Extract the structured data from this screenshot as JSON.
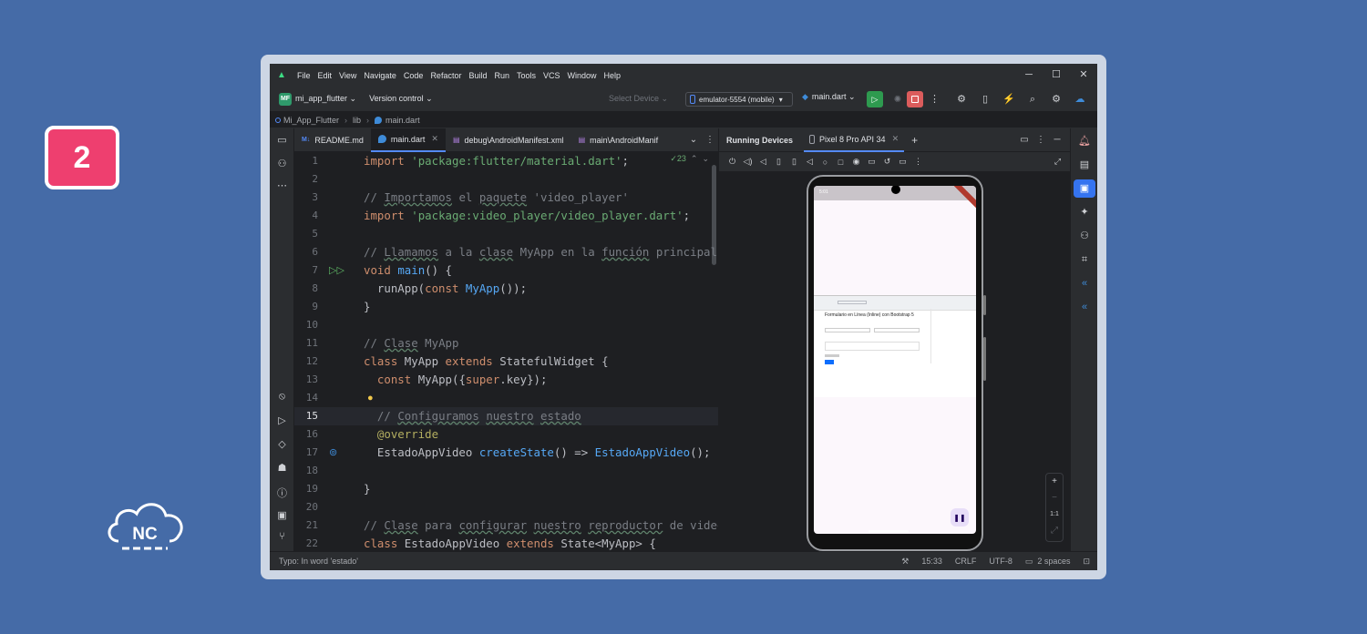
{
  "badge": {
    "number": "2"
  },
  "logo": {
    "text": "NC"
  },
  "menu": [
    "File",
    "Edit",
    "View",
    "Navigate",
    "Code",
    "Refactor",
    "Build",
    "Run",
    "Tools",
    "VCS",
    "Window",
    "Help"
  ],
  "window_controls": {
    "minimize": "─",
    "maximize": "☐",
    "close": "✕"
  },
  "toolbar": {
    "project_badge": "MF",
    "project_name": "mi_app_flutter ⌄",
    "version_control": "Version control ⌄",
    "select_device": "Select Device ⌄",
    "emulator": "emulator-5554 (mobile)",
    "emulator_caret": "▾",
    "run_config": "main.dart ⌄"
  },
  "breadcrumb": {
    "root": "Mi_App_Flutter",
    "folder": "lib",
    "file": "main.dart"
  },
  "tabs": [
    {
      "label": "README.md"
    },
    {
      "label": "main.dart"
    },
    {
      "label": "debug\\AndroidManifest.xml"
    },
    {
      "label": "main\\AndroidManif"
    }
  ],
  "editor": {
    "inspection": "23",
    "current_line": "15"
  },
  "code_lines": [
    "1",
    "2",
    "3",
    "4",
    "5",
    "6",
    "7",
    "8",
    "9",
    "10",
    "11",
    "12",
    "13",
    "14",
    "15",
    "16",
    "17",
    "18",
    "19",
    "20",
    "21",
    "22"
  ],
  "right_panel": {
    "title": "Running Devices",
    "device_tab": "Pixel 8 Pro API 34",
    "add": "+",
    "zoom_in": "+",
    "zoom_out": "−",
    "zoom_reset": "1:1"
  },
  "phone": {
    "time": "5:01",
    "form_title": "Formulario en Línea (Inline) con Bootstrap 5",
    "pause_icon": "❚❚"
  },
  "status": {
    "message": "Typo: In word 'estado'",
    "position": "15:33",
    "line_ending": "CRLF",
    "encoding": "UTF-8",
    "indent": "2 spaces"
  },
  "colors": {
    "background": "#456ba7",
    "badge": "#ee3f6f",
    "run_green": "#2e9a4f",
    "stop_red": "#db5c5c",
    "accent_blue": "#3574f0"
  }
}
